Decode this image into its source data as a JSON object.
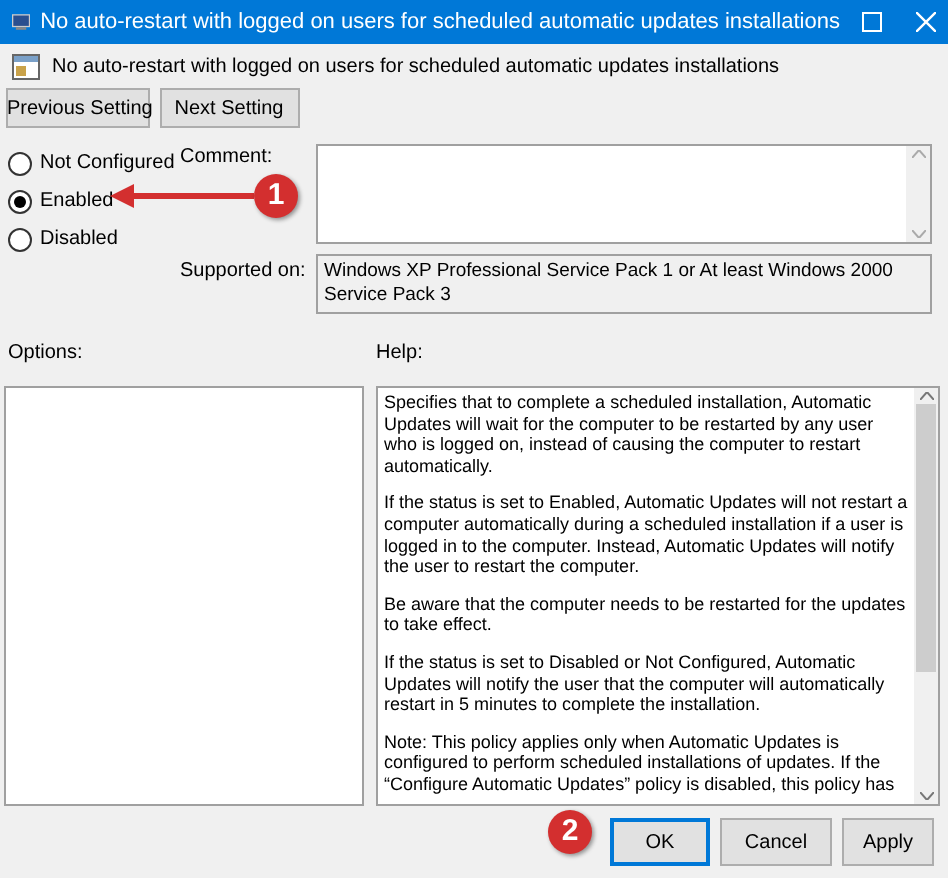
{
  "window": {
    "title": "No auto-restart with logged on users for scheduled automatic updates installations"
  },
  "policy_title": "No auto-restart with logged on users for scheduled automatic updates installations",
  "nav_buttons": [
    "Previous Setting",
    "Next Setting"
  ],
  "states": [
    {
      "label": "Not Configured",
      "selected": false
    },
    {
      "label": "Enabled",
      "selected": true
    },
    {
      "label": "Disabled",
      "selected": false
    }
  ],
  "comment": {
    "label": "Comment:"
  },
  "supported_on": {
    "label": "Supported on:",
    "value": "Windows XP Professional Service Pack 1 or At least Windows 2000 Service Pack 3"
  },
  "options": {
    "label": "Options:"
  },
  "help": {
    "label": "Help:",
    "paragraphs": [
      "Specifies that to complete a scheduled installation, Automatic Updates will wait for the computer to be restarted by any user who is logged on, instead of causing the computer to restart automatically.",
      "If the status is set to Enabled, Automatic Updates will not restart a computer automatically during a scheduled installation if a user is logged in to the computer. Instead, Automatic Updates will notify the user to restart the computer.",
      "Be aware that the computer needs to be restarted for the updates to take effect.",
      "If the status is set to Disabled or Not Configured, Automatic Updates will notify the user that the computer will automatically restart in 5 minutes to complete the installation.",
      "Note: This policy applies only when Automatic Updates is configured to perform scheduled installations of updates. If the “Configure Automatic Updates” policy is disabled, this policy has"
    ]
  },
  "buttons": [
    {
      "label": "OK",
      "selected": true
    },
    {
      "label": "Cancel",
      "selected": false
    },
    {
      "label": "Apply",
      "selected": false
    }
  ],
  "annotations": [
    {
      "label": "1"
    },
    {
      "label": "2"
    }
  ]
}
